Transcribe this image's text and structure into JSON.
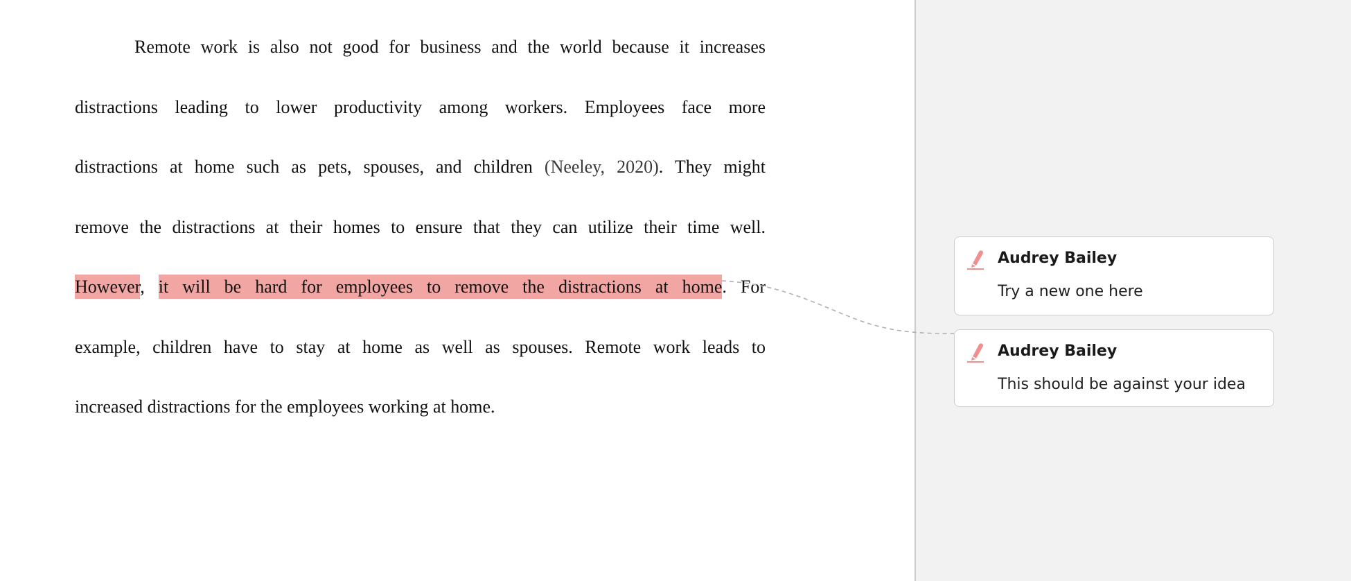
{
  "document": {
    "lines": [
      [
        "Remote work is also not good for business and the world because it increases"
      ],
      [
        "distractions leading to lower productivity among workers. Employees face more"
      ],
      [
        "distractions at home such as pets, spouses, and children ",
        "(Neeley, 2020)",
        ". They might"
      ],
      [
        "remove the distractions at their homes to ensure that they can utilize their time well."
      ],
      [
        "However",
        ", ",
        "it will be hard for employees to remove the distractions at home",
        ". For"
      ],
      [
        "example, children have to stay at home as well as spouses. Remote work leads to"
      ],
      [
        "increased distractions for the employees working at home."
      ]
    ]
  },
  "comments": [
    {
      "author": "Audrey Bailey",
      "text": "Try a new one here",
      "icon": "highlighter-icon"
    },
    {
      "author": "Audrey Bailey",
      "text": "This should be against your idea",
      "icon": "highlighter-icon"
    }
  ],
  "colors": {
    "highlight": "#f2a6a4",
    "margin_pane": "#f2f2f2",
    "icon": "#ef8f8f"
  }
}
